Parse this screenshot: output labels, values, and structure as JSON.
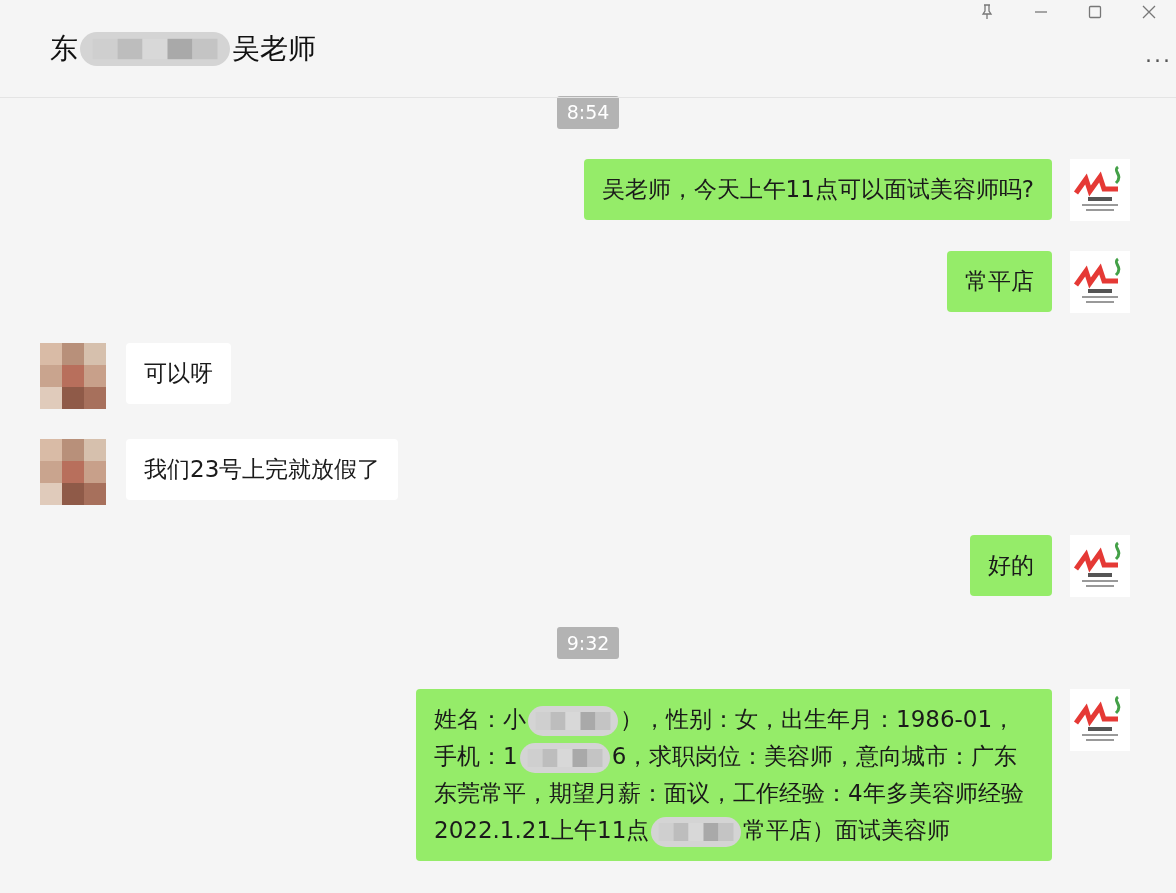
{
  "window": {
    "title": [
      {
        "kind": "text",
        "text": "东"
      },
      {
        "kind": "blur"
      },
      {
        "kind": "text",
        "text": "吴老师"
      }
    ],
    "more": "..."
  },
  "messages": [
    {
      "kind": "time",
      "text": "8:54"
    },
    {
      "kind": "sent",
      "parts": [
        {
          "kind": "text",
          "text": "吴老师，今天上午11点可以面试美容师吗?"
        }
      ]
    },
    {
      "kind": "sent",
      "parts": [
        {
          "kind": "text",
          "text": "常平店"
        }
      ]
    },
    {
      "kind": "received",
      "parts": [
        {
          "kind": "text",
          "text": "可以呀"
        }
      ]
    },
    {
      "kind": "received",
      "parts": [
        {
          "kind": "text",
          "text": "我们23号上完就放假了"
        }
      ]
    },
    {
      "kind": "sent",
      "parts": [
        {
          "kind": "text",
          "text": "好的"
        }
      ]
    },
    {
      "kind": "time",
      "text": "9:32"
    },
    {
      "kind": "sent",
      "parts": [
        {
          "kind": "text",
          "text": "姓名：小"
        },
        {
          "kind": "blur"
        },
        {
          "kind": "text",
          "text": "），性别：女，出生年月：1986-01，手机：1"
        },
        {
          "kind": "blur"
        },
        {
          "kind": "text",
          "text": "6，求职岗位：美容师，意向城市：广东东莞常平，期望月薪：面议，工作经验：4年多美容师经验 2022.1.21上午11点"
        },
        {
          "kind": "blur"
        },
        {
          "kind": "text",
          "text": "常平店）面试美容师"
        }
      ]
    }
  ]
}
